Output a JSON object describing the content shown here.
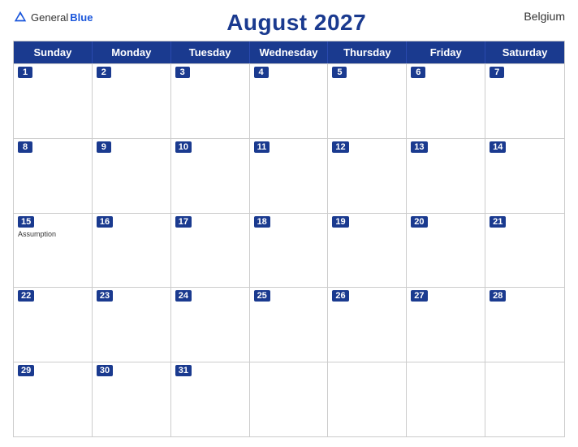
{
  "header": {
    "logo": {
      "general": "General",
      "blue": "Blue",
      "icon_color": "#1a56db"
    },
    "title": "August 2027",
    "country": "Belgium"
  },
  "day_headers": [
    "Sunday",
    "Monday",
    "Tuesday",
    "Wednesday",
    "Thursday",
    "Friday",
    "Saturday"
  ],
  "weeks": [
    [
      {
        "date": 1,
        "holiday": null
      },
      {
        "date": 2,
        "holiday": null
      },
      {
        "date": 3,
        "holiday": null
      },
      {
        "date": 4,
        "holiday": null
      },
      {
        "date": 5,
        "holiday": null
      },
      {
        "date": 6,
        "holiday": null
      },
      {
        "date": 7,
        "holiday": null
      }
    ],
    [
      {
        "date": 8,
        "holiday": null
      },
      {
        "date": 9,
        "holiday": null
      },
      {
        "date": 10,
        "holiday": null
      },
      {
        "date": 11,
        "holiday": null
      },
      {
        "date": 12,
        "holiday": null
      },
      {
        "date": 13,
        "holiday": null
      },
      {
        "date": 14,
        "holiday": null
      }
    ],
    [
      {
        "date": 15,
        "holiday": "Assumption"
      },
      {
        "date": 16,
        "holiday": null
      },
      {
        "date": 17,
        "holiday": null
      },
      {
        "date": 18,
        "holiday": null
      },
      {
        "date": 19,
        "holiday": null
      },
      {
        "date": 20,
        "holiday": null
      },
      {
        "date": 21,
        "holiday": null
      }
    ],
    [
      {
        "date": 22,
        "holiday": null
      },
      {
        "date": 23,
        "holiday": null
      },
      {
        "date": 24,
        "holiday": null
      },
      {
        "date": 25,
        "holiday": null
      },
      {
        "date": 26,
        "holiday": null
      },
      {
        "date": 27,
        "holiday": null
      },
      {
        "date": 28,
        "holiday": null
      }
    ],
    [
      {
        "date": 29,
        "holiday": null
      },
      {
        "date": 30,
        "holiday": null
      },
      {
        "date": 31,
        "holiday": null
      },
      {
        "date": null,
        "holiday": null
      },
      {
        "date": null,
        "holiday": null
      },
      {
        "date": null,
        "holiday": null
      },
      {
        "date": null,
        "holiday": null
      }
    ]
  ]
}
